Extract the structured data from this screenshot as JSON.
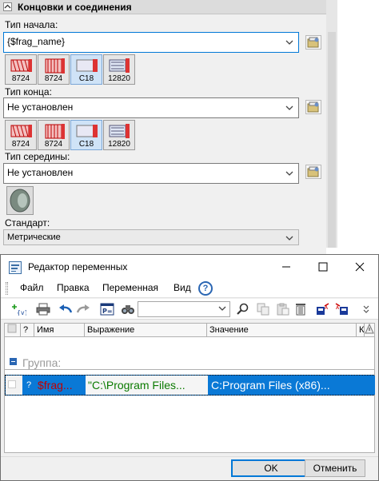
{
  "panel": {
    "section_title": "Концовки и соединения",
    "start_label": "Тип начала:",
    "start_value": "{$frag_name}",
    "start_thumbs": [
      "8724",
      "8724",
      "C18",
      "12820"
    ],
    "end_label": "Тип конца:",
    "end_value": "Не установлен",
    "end_thumbs": [
      "8724",
      "8724",
      "C18",
      "12820"
    ],
    "middle_label": "Тип середины:",
    "middle_value": "Не установлен",
    "standard_label": "Стандарт:",
    "standard_value": "Метрические"
  },
  "window": {
    "title": "Редактор переменных",
    "menu": [
      "Файл",
      "Правка",
      "Переменная",
      "Вид"
    ],
    "help": "?",
    "search_value": "",
    "columns": [
      "Имя",
      "Выражение",
      "Значение",
      "К"
    ],
    "group_label": "Группа:",
    "row": {
      "q": "?",
      "name": "$frag...",
      "expression": "\"C:\\Program Files...",
      "value": "C:Program Files (x86)..."
    },
    "ok_label": "OK",
    "cancel_label": "Отменить"
  },
  "colors": {
    "selection": "#0a79d6",
    "name_red": "#c00000",
    "expr_green": "#0a7a00",
    "focus_blue": "#0078d7"
  },
  "icons": [
    "collapse-icon",
    "settings-icon",
    "fitting-thumbnail",
    "help-icon",
    "add-variable-icon",
    "print-icon",
    "undo-icon",
    "redo-icon",
    "properties-icon",
    "find-icon",
    "copy-icon",
    "paste-icon",
    "delete-icon",
    "import-icon",
    "export-icon",
    "flag-icon",
    "warning-icon"
  ]
}
